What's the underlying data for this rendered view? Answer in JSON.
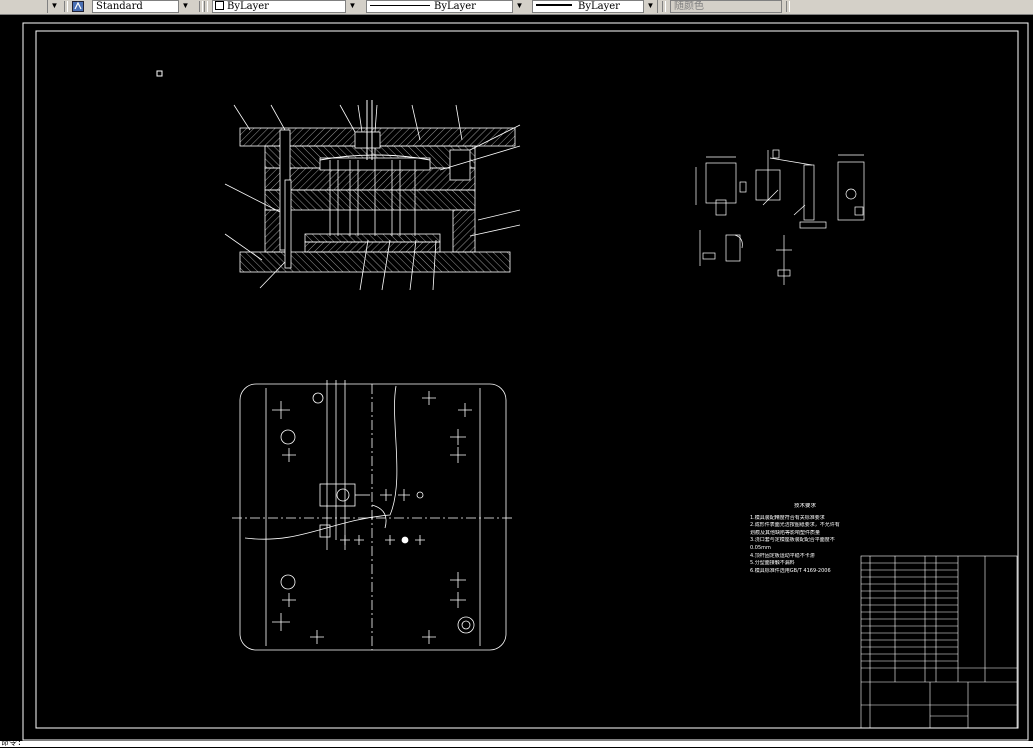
{
  "toolbar": {
    "text_style": "Standard",
    "layer": "ByLayer",
    "linetype": "ByLayer",
    "lineweight": "ByLayer",
    "color": "随颜色"
  },
  "drawing": {
    "tech_title": "技术要求",
    "tech_notes": [
      "1.模具装配精度符合有关标准要求",
      "2.成形件表面光洁按图纸要求，不允许有",
      "  划痕及其他缺陷等影响塑件质量",
      "3.浇口套与定模座板装配配合平面度不",
      "  0.05mm",
      "4.顶杆固定板运动平稳不卡滞",
      "5.分型面接触不漏料",
      "6.模具标准件选用GB/T 4169-2006"
    ]
  },
  "command_line": {
    "prompt": "命令:"
  }
}
